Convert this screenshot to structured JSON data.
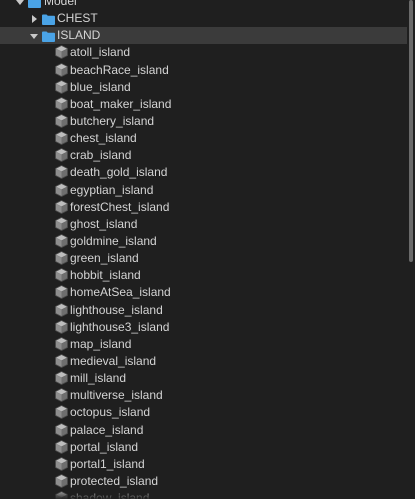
{
  "tree": {
    "root": {
      "label": "Model",
      "icon": "folder-icon",
      "expanded": true
    },
    "folders": [
      {
        "label": "CHEST",
        "icon": "folder-icon",
        "expanded": false
      },
      {
        "label": "ISLAND",
        "icon": "folder-icon",
        "expanded": true,
        "selected": true
      }
    ],
    "island_items": [
      "atoll_island",
      "beachRace_island",
      "blue_island",
      "boat_maker_island",
      "butchery_island",
      "chest_island",
      "crab_island",
      "death_gold_island",
      "egyptian_island",
      "forestChest_island",
      "ghost_island",
      "goldmine_island",
      "green_island",
      "hobbit_island",
      "homeAtSea_island",
      "lighthouse_island",
      "lighthouse3_island",
      "map_island",
      "medieval_island",
      "mill_island",
      "multiverse_island",
      "octopus_island",
      "palace_island",
      "portal_island",
      "portal1_island",
      "protected_island",
      "shadow_island"
    ],
    "item_icon": "model-cube-icon"
  },
  "colors": {
    "background": "#1f1f1f",
    "selected_row": "#3b3b3b",
    "folder_blue": "#4aa3e6",
    "text": "#d4d4d4"
  }
}
